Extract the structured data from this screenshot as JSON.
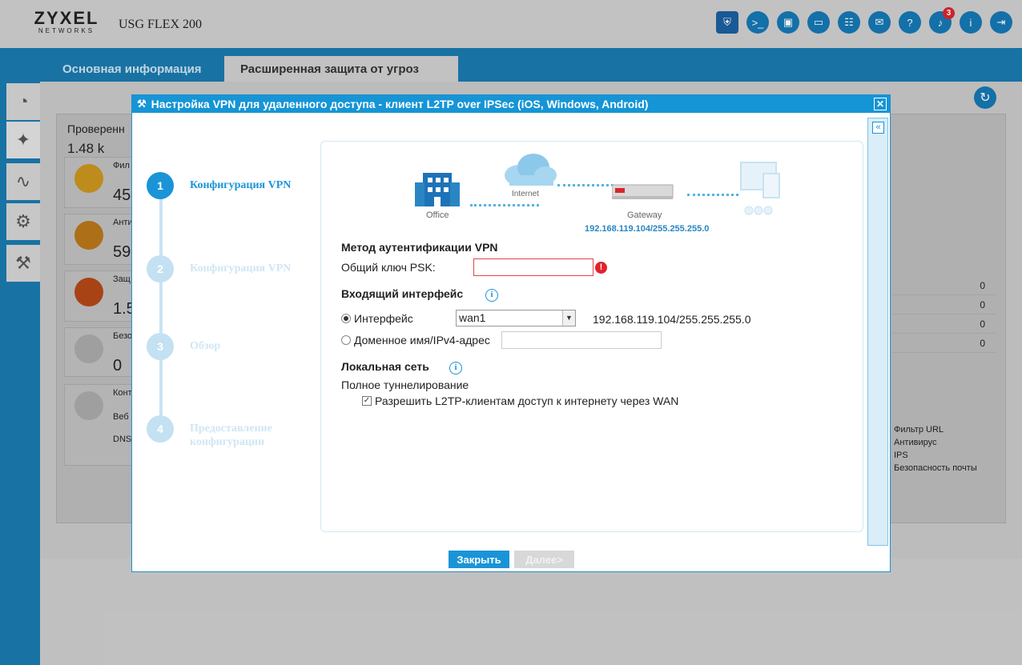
{
  "header": {
    "logo_main": "ZYXEL",
    "logo_sub": "NETWORKS",
    "model": "USG FLEX 200",
    "notification_count": "3",
    "icons": [
      "shield-icon",
      "console-icon",
      "cli-icon",
      "window-icon",
      "sitemap-icon",
      "chat-icon",
      "help-icon",
      "bell-icon",
      "info-icon",
      "logout-icon"
    ]
  },
  "tabs": {
    "basic": "Основная информация",
    "advanced": "Расширенная защита от угроз"
  },
  "background": {
    "checked_label": "Проверенн",
    "checked_value": "1.48 k",
    "cards": [
      {
        "label": "Фил",
        "value": "45"
      },
      {
        "label": "Анти",
        "value": "59"
      },
      {
        "label": "Защ",
        "value": "1.5"
      },
      {
        "label": "Безо",
        "value": "0"
      },
      {
        "label": "Конт",
        "sub1": "Веб",
        "sub2": "DNS"
      }
    ],
    "right_values": [
      "0",
      "0",
      "0",
      "0"
    ],
    "legend": [
      "Фильтр URL",
      "Антивирус",
      "IPS",
      "Безопасность почты"
    ]
  },
  "dialog": {
    "title": "Настройка VPN для удаленного доступа - клиент L2TP over IPSec (iOS, Windows, Android)",
    "steps": [
      {
        "num": "1",
        "label": "Конфигурация VPN"
      },
      {
        "num": "2",
        "label": "Конфигурация VPN"
      },
      {
        "num": "3",
        "label": "Обзор"
      },
      {
        "num": "4",
        "label": "Предоставление конфигурации"
      }
    ],
    "diagram": {
      "office": "Office",
      "internet": "Internet",
      "gateway": "Gateway",
      "gateway_ip": "192.168.119.104/255.255.255.0"
    },
    "auth_heading": "Метод аутентификации VPN",
    "psk_label": "Общий ключ PSK:",
    "psk_value": "",
    "iface_heading": "Входящий интерфейс",
    "iface_radio": "Интерфейс",
    "iface_selected": "wan1",
    "iface_ip": "192.168.119.104/255.255.255.0",
    "domain_radio": "Доменное имя/IPv4-адрес",
    "domain_value": "",
    "lan_heading": "Локальная сеть",
    "full_tunnel": "Полное туннелирование",
    "allow_wan": "Разрешить L2TP-клиентам доступ к интернету через WAN",
    "close_btn": "Закрыть",
    "next_btn": "Далее>"
  }
}
